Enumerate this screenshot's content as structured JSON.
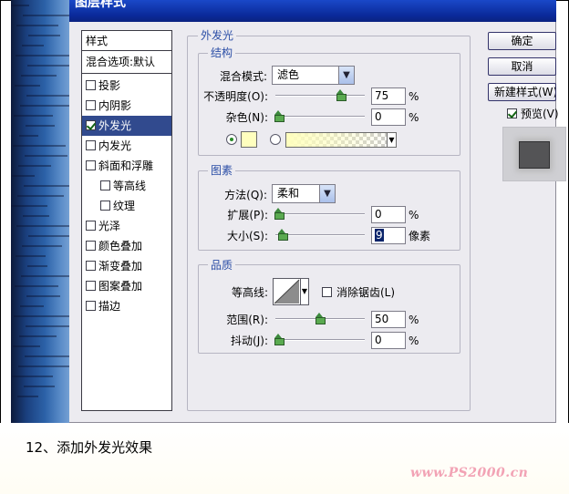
{
  "dialog": {
    "title": "图层样式",
    "buttons": {
      "ok": "确定",
      "cancel": "取消",
      "new_style": "新建样式(W)",
      "preview": "预览(V)"
    },
    "preview_checked": true
  },
  "stylelist": {
    "header": "样式",
    "blend": "混合选项:默认",
    "items": [
      {
        "label": "投影",
        "checked": false,
        "sub": false,
        "selected": false
      },
      {
        "label": "内阴影",
        "checked": false,
        "sub": false,
        "selected": false
      },
      {
        "label": "外发光",
        "checked": true,
        "sub": false,
        "selected": true
      },
      {
        "label": "内发光",
        "checked": false,
        "sub": false,
        "selected": false
      },
      {
        "label": "斜面和浮雕",
        "checked": false,
        "sub": false,
        "selected": false
      },
      {
        "label": "等高线",
        "checked": false,
        "sub": true,
        "selected": false
      },
      {
        "label": "纹理",
        "checked": false,
        "sub": true,
        "selected": false
      },
      {
        "label": "光泽",
        "checked": false,
        "sub": false,
        "selected": false
      },
      {
        "label": "颜色叠加",
        "checked": false,
        "sub": false,
        "selected": false
      },
      {
        "label": "渐变叠加",
        "checked": false,
        "sub": false,
        "selected": false
      },
      {
        "label": "图案叠加",
        "checked": false,
        "sub": false,
        "selected": false
      },
      {
        "label": "描边",
        "checked": false,
        "sub": false,
        "selected": false
      }
    ]
  },
  "outer_glow": {
    "title": "外发光",
    "structure": {
      "title": "结构",
      "blend_mode_label": "混合模式:",
      "blend_mode_value": "滤色",
      "opacity_label": "不透明度(O):",
      "opacity_value": "75",
      "opacity_unit": "%",
      "opacity_fraction": 0.75,
      "noise_label": "杂色(N):",
      "noise_value": "0",
      "noise_unit": "%",
      "noise_fraction": 0,
      "glow_color": "#ffffbe"
    },
    "elements": {
      "title": "图素",
      "technique_label": "方法(Q):",
      "technique_value": "柔和",
      "spread_label": "扩展(P):",
      "spread_value": "0",
      "spread_unit": "%",
      "spread_fraction": 0,
      "size_label": "大小(S):",
      "size_value": "9",
      "size_unit": "像素",
      "size_fraction": 0.04
    },
    "quality": {
      "title": "品质",
      "contour_label": "等高线:",
      "antialias_label": "消除锯齿(L)",
      "antialias_checked": false,
      "range_label": "范围(R):",
      "range_value": "50",
      "range_unit": "%",
      "range_fraction": 0.5,
      "jitter_label": "抖动(J):",
      "jitter_value": "0",
      "jitter_unit": "%",
      "jitter_fraction": 0
    }
  },
  "caption": "12、添加外发光效果",
  "watermark": "www.PS2000.cn"
}
